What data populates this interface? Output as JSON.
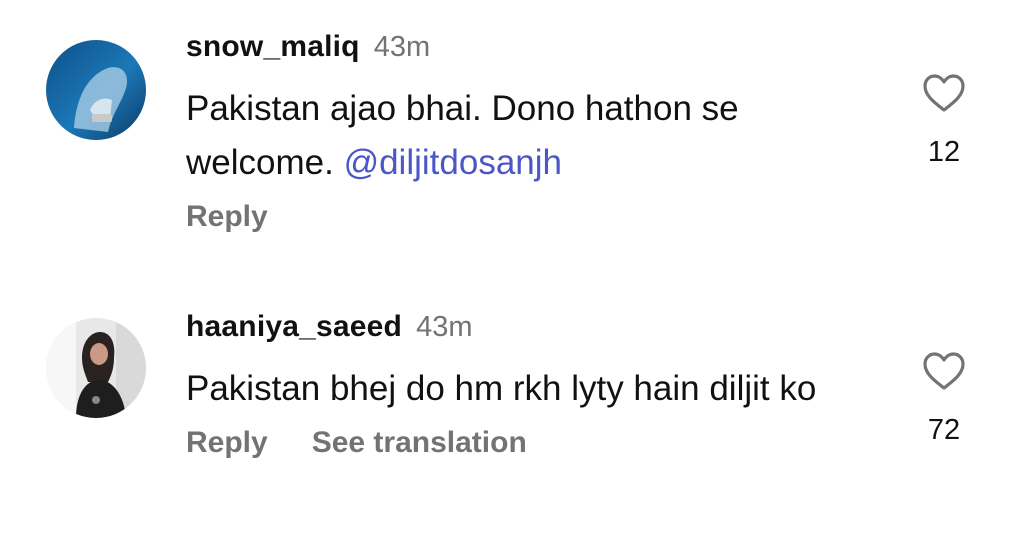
{
  "comments": [
    {
      "username": "snow_maliq",
      "time": "43m",
      "text_prefix": "Pakistan ajao bhai. Dono hathon se welcome. ",
      "mention": "@diljitdosanjh",
      "actions": [
        "Reply"
      ],
      "likes": "12",
      "like_icon": "heart-outline-icon"
    },
    {
      "username": "haaniya_saeed",
      "time": "43m",
      "text_prefix": "Pakistan bhej do hm rkh lyty hain diljit ko",
      "mention": "",
      "actions": [
        "Reply",
        "See translation"
      ],
      "likes": "72",
      "like_icon": "heart-outline-icon"
    }
  ],
  "colors": {
    "text": "#111111",
    "muted": "#737373",
    "mention": "#4b56c9",
    "background": "#ffffff"
  }
}
